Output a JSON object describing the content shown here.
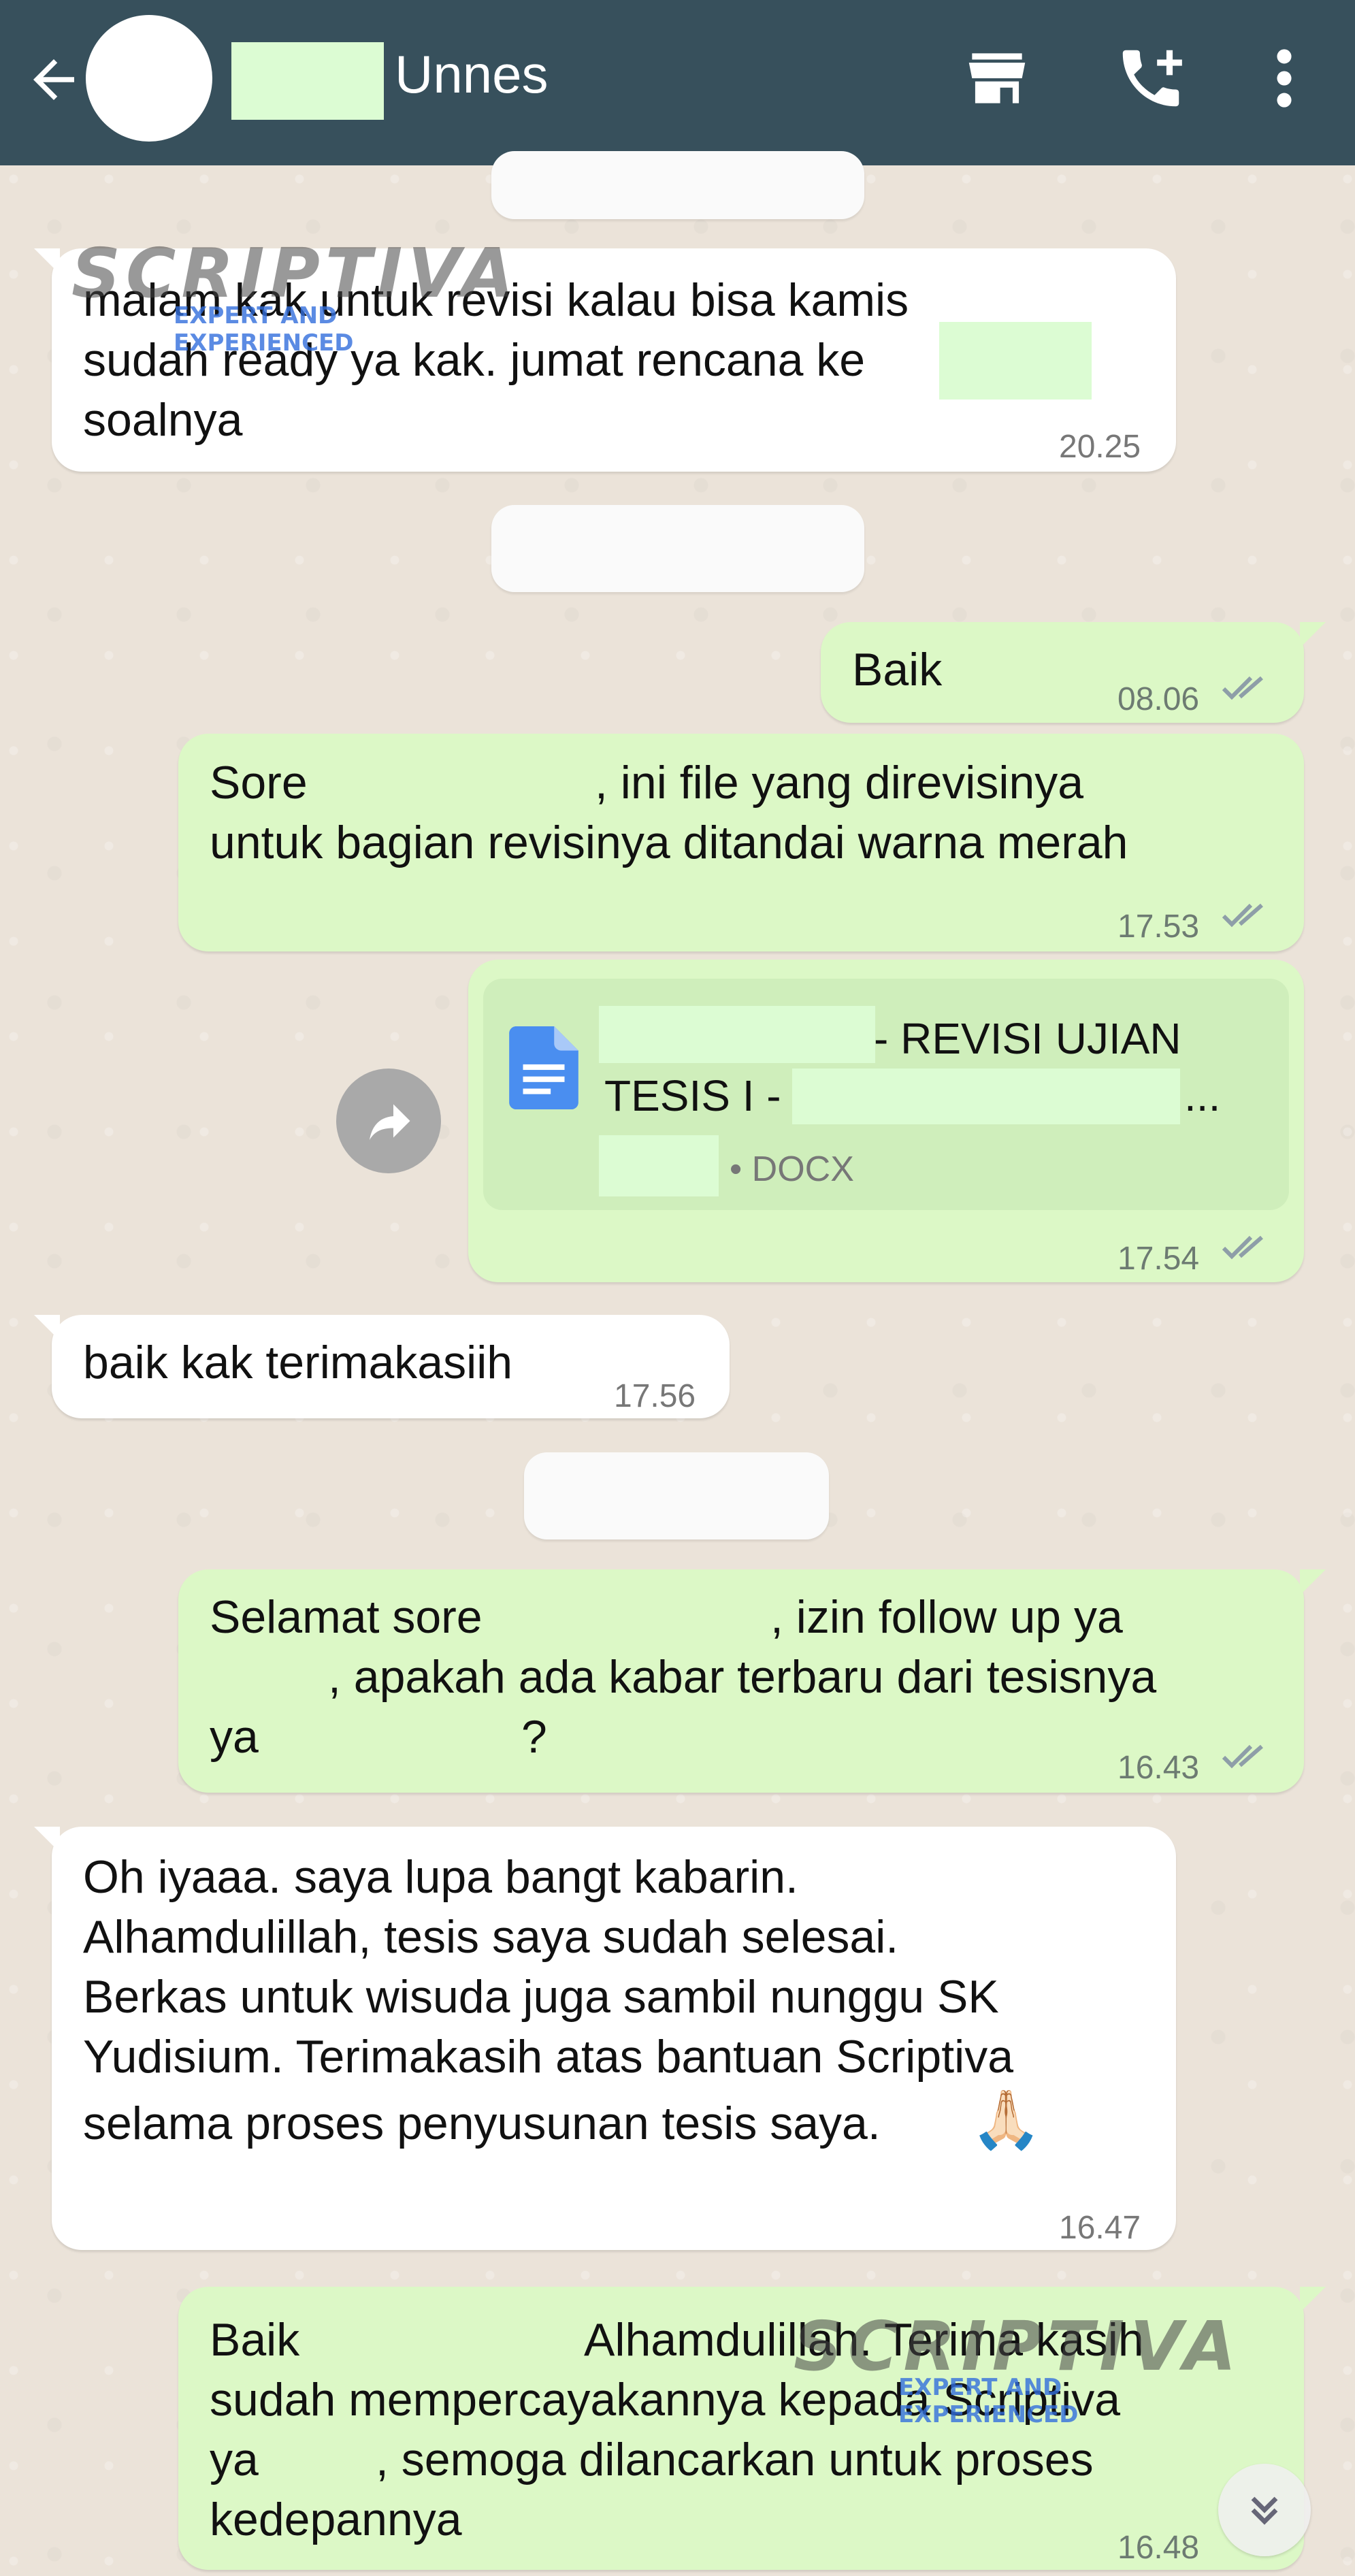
{
  "header": {
    "contact_name": "Unnes"
  },
  "messages": {
    "m1": {
      "line1": "malam kak untuk revisi kalau bisa kamis",
      "line2": "sudah ready ya kak. jumat rencana ke",
      "line3": "soalnya",
      "time": "20.25"
    },
    "m2": {
      "text": "Baik",
      "time": "08.06"
    },
    "m3": {
      "line1a": "Sore",
      "line1b": ", ini file yang direvisinya",
      "line2": "untuk bagian revisinya ditandai warna merah",
      "time": "17.53"
    },
    "m4": {
      "doc_line1": "- REVISI UJIAN",
      "doc_line2a": "TESIS I -",
      "doc_line2b": "...",
      "doc_type": "• DOCX",
      "time": "17.54"
    },
    "m5": {
      "text": "baik kak terimakasiih",
      "time": "17.56"
    },
    "m6": {
      "line1a": "Selamat sore",
      "line1b": ", izin follow up ya",
      "line2": ", apakah ada kabar terbaru dari tesisnya",
      "line3a": "ya",
      "line3b": "?",
      "time": "16.43"
    },
    "m7": {
      "line1": "Oh iyaaa. saya lupa bangt kabarin.",
      "line2": "Alhamdulillah, tesis saya sudah selesai.",
      "line3": "Berkas untuk wisuda juga sambil nunggu SK",
      "line4": "Yudisium. Terimakasih atas bantuan Scriptiva",
      "line5": "selama proses penyusunan tesis saya.",
      "emoji": "🙏🏻",
      "time": "16.47"
    },
    "m8": {
      "line1a": "Baik",
      "line1b": "Alhamdulillah. Terima kasih",
      "line2": "sudah mempercayakannya kepada Scriptiva",
      "line3a": "ya",
      "line3b": ", semoga dilancarkan untuk proses",
      "line4": "kedepannya",
      "time": "16.48"
    }
  },
  "watermark": {
    "logo": "SCRIPTIVA",
    "tagline": "EXPERT AND EXPERIENCED"
  },
  "icons": {
    "back": "arrow-back-icon",
    "store": "store-icon",
    "call": "add-call-icon",
    "menu": "more-vert-icon",
    "doc": "document-icon",
    "forward": "forward-icon",
    "scroll": "double-chevron-down-icon"
  },
  "colors": {
    "header": "#37505c",
    "outgoing": "#dcf8c6",
    "incoming": "#ffffff",
    "read_ticks": "#8e9ea8",
    "doc_icon": "#4a8ef0"
  }
}
